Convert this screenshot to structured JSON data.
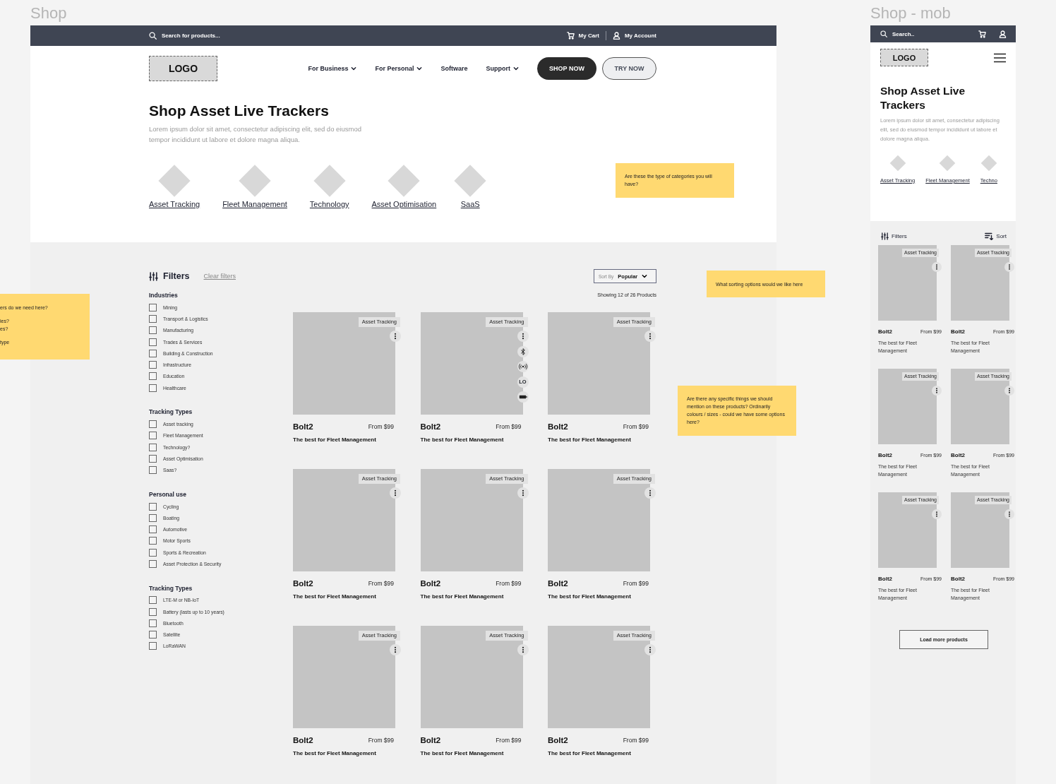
{
  "desktop": {
    "frame_title": "Shop",
    "top_bar": {
      "search_placeholder": "Search for products...",
      "cart": "My Cart",
      "account": "My Account"
    },
    "logo": "LOGO",
    "nav": [
      {
        "label": "For Business",
        "has_menu": true
      },
      {
        "label": "For Personal",
        "has_menu": true
      },
      {
        "label": "Software",
        "has_menu": false
      },
      {
        "label": "Support",
        "has_menu": true
      }
    ],
    "buttons": [
      {
        "label": "SHOP NOW",
        "kind": "primary"
      },
      {
        "label": "TRY NOW",
        "kind": "secondary"
      }
    ],
    "title": "Shop Asset Live Trackers",
    "intro": "Lorem ipsum dolor sit amet, consectetur adipiscing elit, sed do eiusmod tempor incididunt ut labore et dolore magna aliqua.",
    "categories": [
      "Asset Tracking",
      "Fleet Management",
      "Technology",
      "Asset Optimisation",
      "SaaS"
    ],
    "filters": {
      "title": "Filters",
      "clear": "Clear filters",
      "groups": [
        {
          "heading": "Industries",
          "options": [
            {
              "label": "Mining",
              "checked": false
            },
            {
              "label": "Transport & Logistics",
              "checked": false
            },
            {
              "label": "Manufacturing",
              "checked": false
            },
            {
              "label": "Trades & Services",
              "checked": false
            },
            {
              "label": "Building & Construction",
              "checked": false
            },
            {
              "label": "Infrastructure",
              "checked": false
            },
            {
              "label": "Education",
              "checked": false
            },
            {
              "label": "Healthcare",
              "checked": false
            }
          ]
        },
        {
          "heading": "Tracking Types",
          "options": [
            {
              "label": "Asset tracking",
              "checked": false
            },
            {
              "label": "Fleet Management",
              "checked": false
            },
            {
              "label": "Technology?",
              "checked": false
            },
            {
              "label": "Asset Optimisation",
              "checked": false
            },
            {
              "label": "Saas?",
              "checked": false
            }
          ]
        },
        {
          "heading": "Personal use",
          "options": [
            {
              "label": "Cycling",
              "checked": false
            },
            {
              "label": "Boating",
              "checked": false
            },
            {
              "label": "Automotive",
              "checked": false
            },
            {
              "label": "Motor Sports",
              "checked": false
            },
            {
              "label": "Sports & Recreation",
              "checked": false
            },
            {
              "label": "Asset Protection & Security",
              "checked": false
            }
          ]
        },
        {
          "heading": "Tracking Types",
          "options": [
            {
              "label": "LTE-M or NB-IoT",
              "checked": false
            },
            {
              "label": "Battery (lasts up to 10 years)",
              "checked": false
            },
            {
              "label": "Bluetooth",
              "checked": false
            },
            {
              "label": "Satellite",
              "checked": false
            },
            {
              "label": "LoRaWAN",
              "checked": false
            }
          ]
        }
      ]
    },
    "sort": {
      "label": "Sort By",
      "value": "Popular"
    },
    "showing": "Showing 12 of 26 Products",
    "products": [
      {
        "tag": "Asset Tracking",
        "name": "Bolt2",
        "price": "From $99",
        "description": "The best for Fleet Management"
      },
      {
        "tag": "Asset Tracking",
        "name": "Bolt2",
        "price": "From $99",
        "description": "The best for Fleet Management",
        "features": [
          {
            "kind": "bluetooth"
          },
          {
            "kind": "signal"
          },
          {
            "kind": "label",
            "text": "LO"
          },
          {
            "kind": "battery"
          }
        ]
      },
      {
        "tag": "Asset Tracking",
        "name": "Bolt2",
        "price": "From $99",
        "description": "The best for Fleet Management"
      },
      {
        "tag": "Asset Tracking",
        "name": "Bolt2",
        "price": "From $99",
        "description": "The best for Fleet Management"
      },
      {
        "tag": "Asset Tracking",
        "name": "Bolt2",
        "price": "From $99",
        "description": "The best for Fleet Management"
      },
      {
        "tag": "Asset Tracking",
        "name": "Bolt2",
        "price": "From $99",
        "description": "The best for Fleet Management"
      },
      {
        "tag": "Asset Tracking",
        "name": "Bolt2",
        "price": "From $99",
        "description": "The best for Fleet Management"
      },
      {
        "tag": "Asset Tracking",
        "name": "Bolt2",
        "price": "From $99",
        "description": "The best for Fleet Management"
      },
      {
        "tag": "Asset Tracking",
        "name": "Bolt2",
        "price": "From $99",
        "description": "The best for Fleet Management"
      }
    ]
  },
  "mobile": {
    "frame_title": "Shop - mob",
    "search_placeholder": "Search..",
    "logo": "LOGO",
    "title": "Shop Asset Live Trackers",
    "intro": "Lorem ipsum dolor sit amet, consectetur adipiscing elit, sed do eiusmod tempor incididunt ut labore et dolore magna aliqua.",
    "categories": [
      "Asset Tracking",
      "Fleet Management",
      "Techno"
    ],
    "filters": "Filters",
    "sort": "Sort",
    "products": [
      {
        "tag": "Asset Tracking",
        "name": "Bolt2",
        "price": "From $99",
        "description": "The best for Fleet Management"
      },
      {
        "tag": "Asset Tracking",
        "name": "Bolt2",
        "price": "From $99",
        "description": "The best for Fleet Management"
      },
      {
        "tag": "Asset Tracking",
        "name": "Bolt2",
        "price": "From $99",
        "description": "The best for Fleet Management"
      },
      {
        "tag": "Asset Tracking",
        "name": "Bolt2",
        "price": "From $99",
        "description": "The best for Fleet Management"
      },
      {
        "tag": "Asset Tracking",
        "name": "Bolt2",
        "price": "From $99",
        "description": "The best for Fleet Management"
      },
      {
        "tag": "Asset Tracking",
        "name": "Bolt2",
        "price": "From $99",
        "description": "The best for Fleet Management"
      }
    ],
    "load_more": "Load more products"
  },
  "notes": [
    {
      "paragraphs": [
        "Are these the type of categories you will have?"
      ]
    },
    {
      "paragraphs": [
        "What sorting options would we like here"
      ]
    },
    {
      "paragraphs": [
        "Are there any specific things we should mention on these products? Ordinarily colours / sizes - could we have some options here?"
      ]
    },
    {
      "paragraphs": [
        "ers do we need here?",
        "ies?\nes?",
        "type"
      ]
    }
  ]
}
